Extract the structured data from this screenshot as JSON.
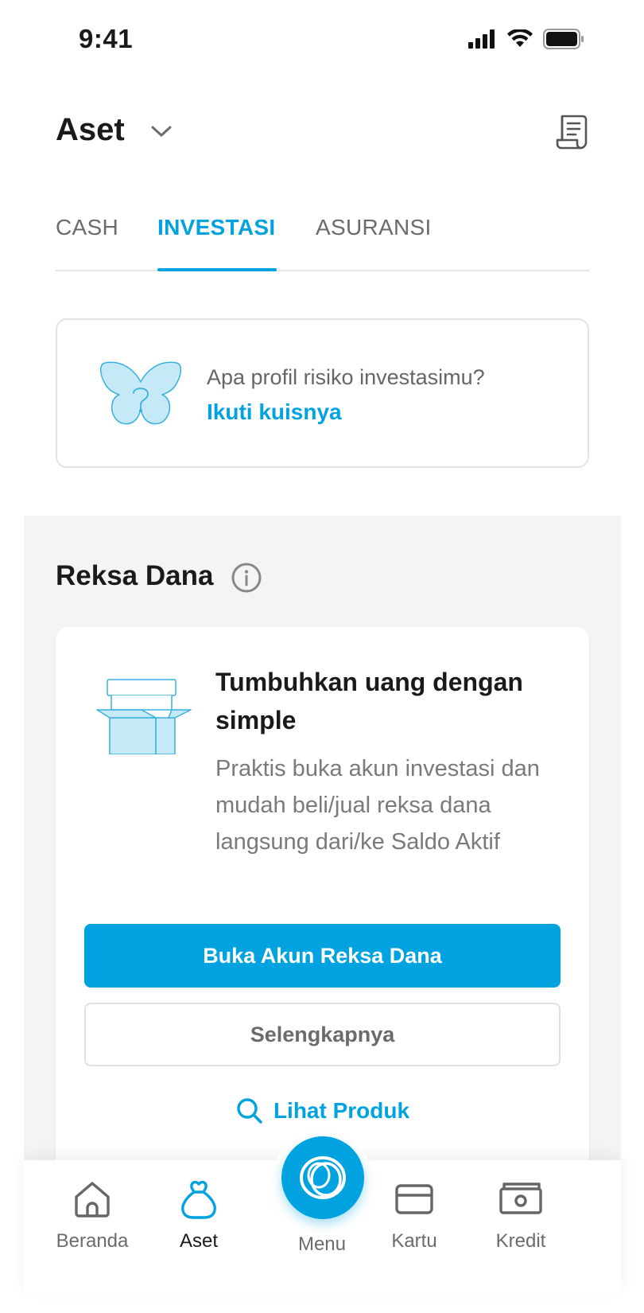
{
  "status_bar": {
    "time": "9:41",
    "icons": [
      "signal-icon",
      "wifi-icon",
      "battery-icon"
    ]
  },
  "header": {
    "title": "Aset",
    "dropdown_icon": "chevron-down-icon",
    "right_icon": "statement-document-icon"
  },
  "tabs": {
    "items": [
      {
        "label": "CASH",
        "active": false
      },
      {
        "label": "INVESTASI",
        "active": true
      },
      {
        "label": "ASURANSI",
        "active": false
      }
    ]
  },
  "risk_card": {
    "icon": "butterfly-question-icon",
    "question": "Apa profil risiko investasimu?",
    "link_label": "Ikuti kuisnya"
  },
  "reksa_dana": {
    "title": "Reksa Dana",
    "info_icon": "info-icon",
    "card": {
      "icon": "open-box-icon",
      "heading": "Tumbuhkan uang dengan simple",
      "description": "Praktis buka akun investasi dan mudah beli/jual reksa dana langsung dari/ke Saldo Aktif",
      "primary_button": "Buka Akun Reksa Dana",
      "secondary_button": "Selengkapnya",
      "link_icon": "search-icon",
      "link_label": "Lihat Produk"
    }
  },
  "bottom_nav": {
    "items": [
      {
        "label": "Beranda",
        "icon": "home-icon",
        "active": false
      },
      {
        "label": "Aset",
        "icon": "money-bag-icon",
        "active": true
      },
      {
        "label": "Menu",
        "icon": "menu-logo-icon",
        "active": false
      },
      {
        "label": "Kartu",
        "icon": "card-icon",
        "active": false
      },
      {
        "label": "Kredit",
        "icon": "cash-icon",
        "active": false
      }
    ]
  },
  "colors": {
    "accent": "#00a3e0",
    "text_primary": "#1a1a1a",
    "text_secondary": "#6b6b6b",
    "section_bg": "#f4f4f4",
    "icon_fill_light": "#c6e9f7"
  }
}
